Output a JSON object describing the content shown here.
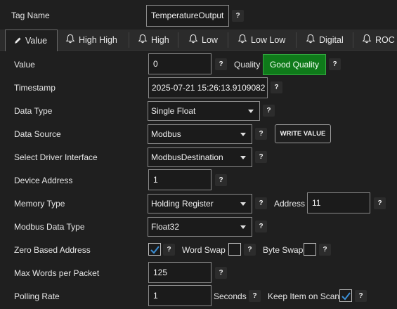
{
  "tag": {
    "label": "Tag Name",
    "value": "TemperatureOutput"
  },
  "tabs": [
    {
      "label": "Value",
      "icon": "pencil-icon"
    },
    {
      "label": "High High",
      "icon": "bell-icon"
    },
    {
      "label": "High",
      "icon": "bell-icon"
    },
    {
      "label": "Low",
      "icon": "bell-icon"
    },
    {
      "label": "Low Low",
      "icon": "bell-icon"
    },
    {
      "label": "Digital",
      "icon": "bell-icon"
    },
    {
      "label": "ROC",
      "icon": "bell-icon"
    }
  ],
  "help_glyph": "?",
  "fields": {
    "value": {
      "label": "Value",
      "value": "0"
    },
    "quality": {
      "label": "Quality",
      "value": "Good Quality",
      "color": "#0f7a1a"
    },
    "timestamp": {
      "label": "Timestamp",
      "value": "2025-07-21 15:26:13.9109082"
    },
    "data_type": {
      "label": "Data Type",
      "value": "Single Float"
    },
    "data_source": {
      "label": "Data Source",
      "value": "Modbus"
    },
    "write_value": {
      "label": "WRITE VALUE"
    },
    "driver_interface": {
      "label": "Select Driver Interface",
      "value": "ModbusDestination"
    },
    "device_address": {
      "label": "Device Address",
      "value": "1"
    },
    "memory_type": {
      "label": "Memory Type",
      "value": "Holding Register"
    },
    "address": {
      "label": "Address",
      "value": "11"
    },
    "modbus_data_type": {
      "label": "Modbus Data Type",
      "value": "Float32"
    },
    "zero_based": {
      "label": "Zero Based Address",
      "checked": true
    },
    "word_swap": {
      "label": "Word Swap",
      "checked": false
    },
    "byte_swap": {
      "label": "Byte Swap",
      "checked": false
    },
    "max_words": {
      "label": "Max Words per Packet",
      "value": "125"
    },
    "polling_rate": {
      "label": "Polling Rate",
      "value": "1",
      "unit": "Seconds"
    },
    "keep_on_scan": {
      "label": "Keep Item on Scan",
      "checked": true
    }
  }
}
